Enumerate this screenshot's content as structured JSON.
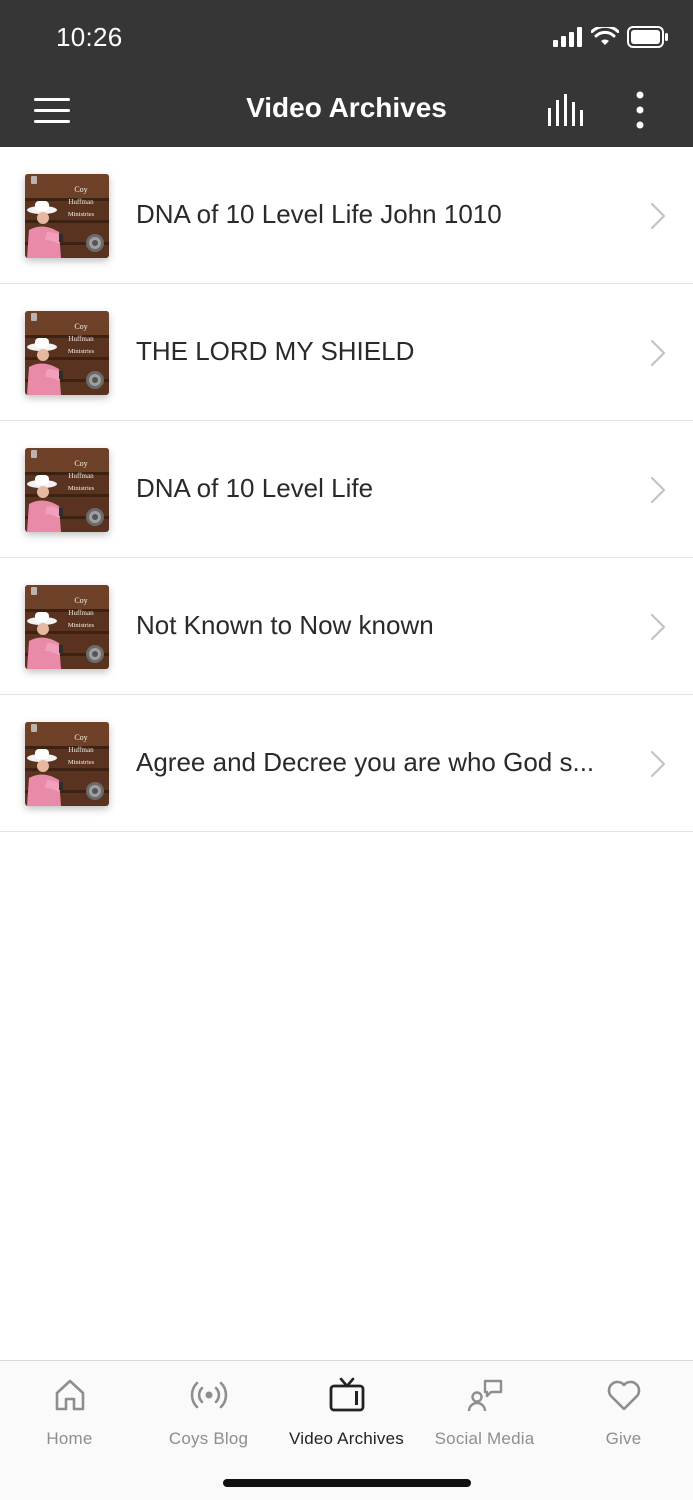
{
  "status": {
    "time": "10:26"
  },
  "header": {
    "title": "Video Archives"
  },
  "thumbnail": {
    "line1": "Coy",
    "line2": "Huffman",
    "line3": "Ministries"
  },
  "videos": [
    {
      "title": "DNA of 10 Level Life John 1010"
    },
    {
      "title": "THE LORD MY SHIELD"
    },
    {
      "title": "DNA of 10 Level Life"
    },
    {
      "title": "Not Known to Now known"
    },
    {
      "title": "Agree and Decree you are who God s..."
    }
  ],
  "tabs": [
    {
      "label": "Home",
      "icon": "home-icon"
    },
    {
      "label": "Coys Blog",
      "icon": "broadcast-icon"
    },
    {
      "label": "Video Archives",
      "icon": "tv-icon",
      "active": true
    },
    {
      "label": "Social Media",
      "icon": "social-icon"
    },
    {
      "label": "Give",
      "icon": "heart-icon"
    }
  ],
  "colors": {
    "header_bg": "#363636",
    "active_tab": "#222222",
    "inactive_tab": "#8e8e8e"
  }
}
